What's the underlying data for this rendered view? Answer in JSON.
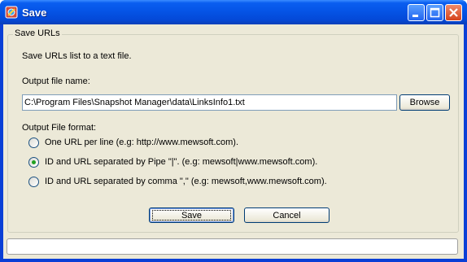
{
  "window": {
    "title": "Save",
    "icons": [
      "app-icon",
      "minimize-icon",
      "maximize-icon",
      "close-icon"
    ]
  },
  "group": {
    "legend": "Save URLs",
    "description": "Save URLs list to a text file.",
    "output_label": "Output file name:",
    "output_value": "C:\\Program Files\\Snapshot Manager\\data\\LinksInfo1.txt",
    "browse_label": "Browse",
    "format_label": "Output File format:",
    "formats": [
      {
        "label": "One URL per line (e.g: http://www.mewsoft.com).",
        "selected": false
      },
      {
        "label": "ID and URL separated by Pipe \"|\". (e.g: mewsoft|www.mewsoft.com).",
        "selected": true
      },
      {
        "label": "ID and URL separated by comma \",\" (e.g: mewsoft,www.mewsoft.com).",
        "selected": false
      }
    ]
  },
  "buttons": {
    "save": "Save",
    "cancel": "Cancel"
  },
  "statusbar": {
    "text": ""
  },
  "colors": {
    "titlebar": "#0554e6",
    "frame": "#0a3fd6",
    "dialog_bg": "#ece9d8",
    "radio_dot": "#21a121"
  }
}
